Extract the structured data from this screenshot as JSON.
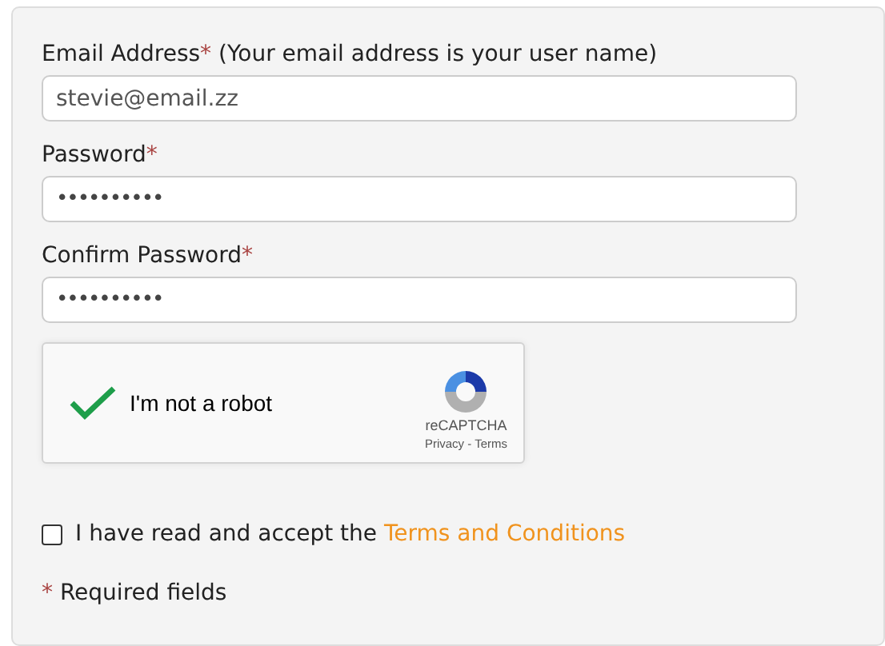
{
  "fields": [
    {
      "label": "Email Address",
      "required_mark": "*",
      "hint": "(Your email address is your user name)",
      "value": "stevie@email.zz",
      "masked": false
    },
    {
      "label": "Password",
      "required_mark": "*",
      "value": "••••••••••",
      "masked": true
    },
    {
      "label": "Confirm Password",
      "required_mark": "*",
      "value": "••••••••••",
      "masked": true
    }
  ],
  "captcha": {
    "label": "I'm not a robot",
    "checked": true,
    "brand": "reCAPTCHA",
    "privacy": "Privacy",
    "separator": "-",
    "terms": "Terms"
  },
  "terms": {
    "checked": false,
    "text": "I have read and accept the",
    "link": "Terms and Conditions"
  },
  "required_note": {
    "mark": "*",
    "text": "Required fields"
  }
}
